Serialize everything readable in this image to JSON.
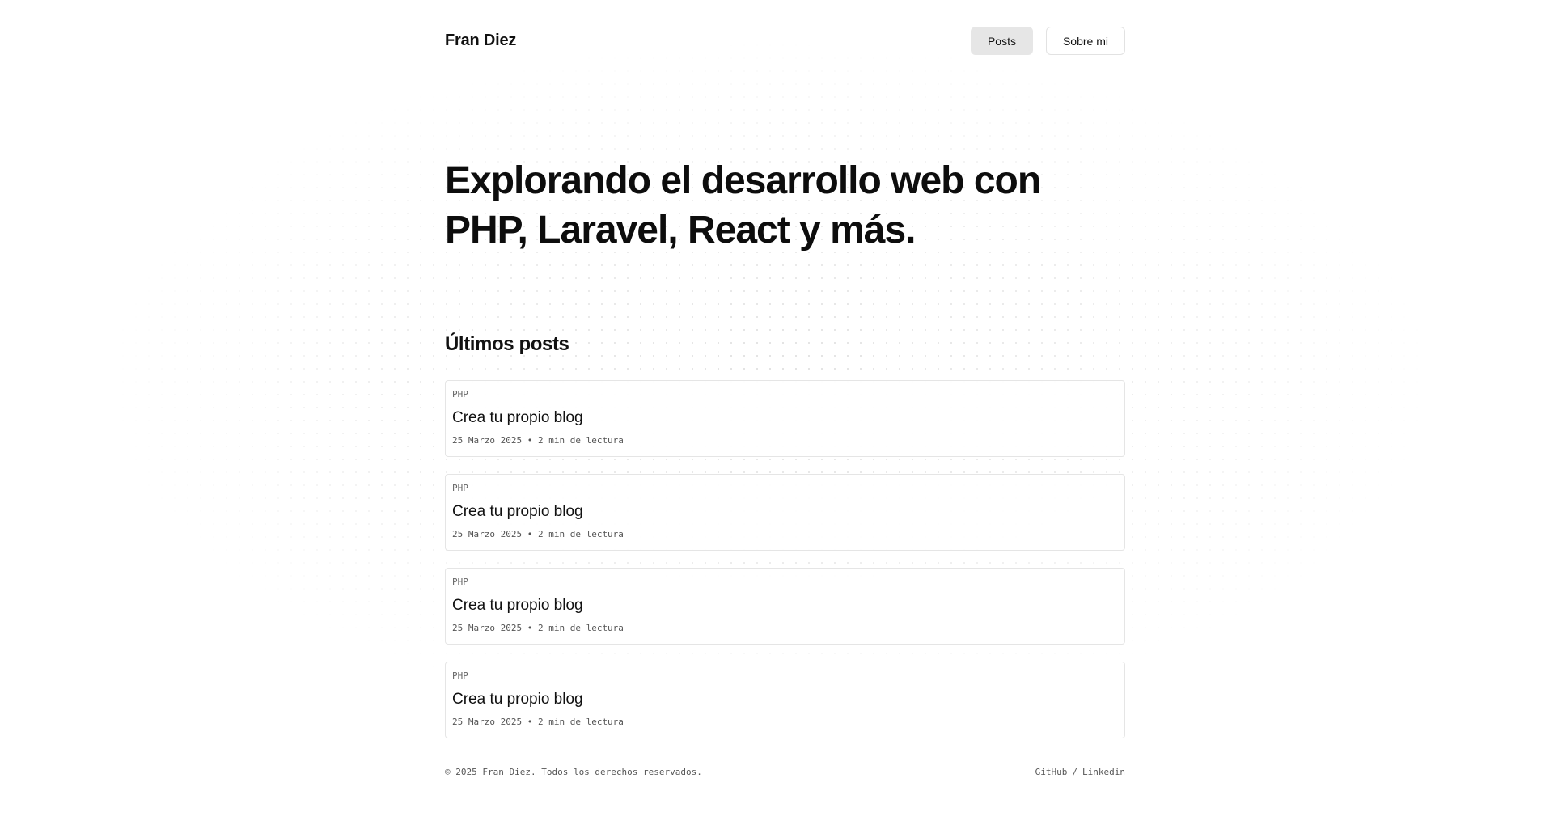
{
  "header": {
    "brand": "Fran Diez",
    "nav": [
      {
        "label": "Posts",
        "active": true
      },
      {
        "label": "Sobre mi",
        "active": false
      }
    ]
  },
  "hero": {
    "title": "Explorando el desarrollo web con PHP, Laravel, React y más."
  },
  "latest": {
    "heading": "Últimos posts",
    "posts": [
      {
        "tag": "PHP",
        "title": "Crea tu propio blog",
        "date": "25 Marzo 2025",
        "bullet": "•",
        "read_time": "2 min de lectura"
      },
      {
        "tag": "PHP",
        "title": "Crea tu propio blog",
        "date": "25 Marzo 2025",
        "bullet": "•",
        "read_time": "2 min de lectura"
      },
      {
        "tag": "PHP",
        "title": "Crea tu propio blog",
        "date": "25 Marzo 2025",
        "bullet": "•",
        "read_time": "2 min de lectura"
      },
      {
        "tag": "PHP",
        "title": "Crea tu propio blog",
        "date": "25 Marzo 2025",
        "bullet": "•",
        "read_time": "2 min de lectura"
      }
    ]
  },
  "footer": {
    "copyright": "© 2025 Fran Diez. Todos los derechos reservados.",
    "links": [
      {
        "label": "GitHub"
      },
      {
        "label": "Linkedin"
      }
    ],
    "separator": "/"
  },
  "colors": {
    "background": "#ffffff",
    "text": "#111111",
    "muted": "#555555",
    "border": "#e5e5e5",
    "active_nav_bg": "#e6e6e6"
  }
}
